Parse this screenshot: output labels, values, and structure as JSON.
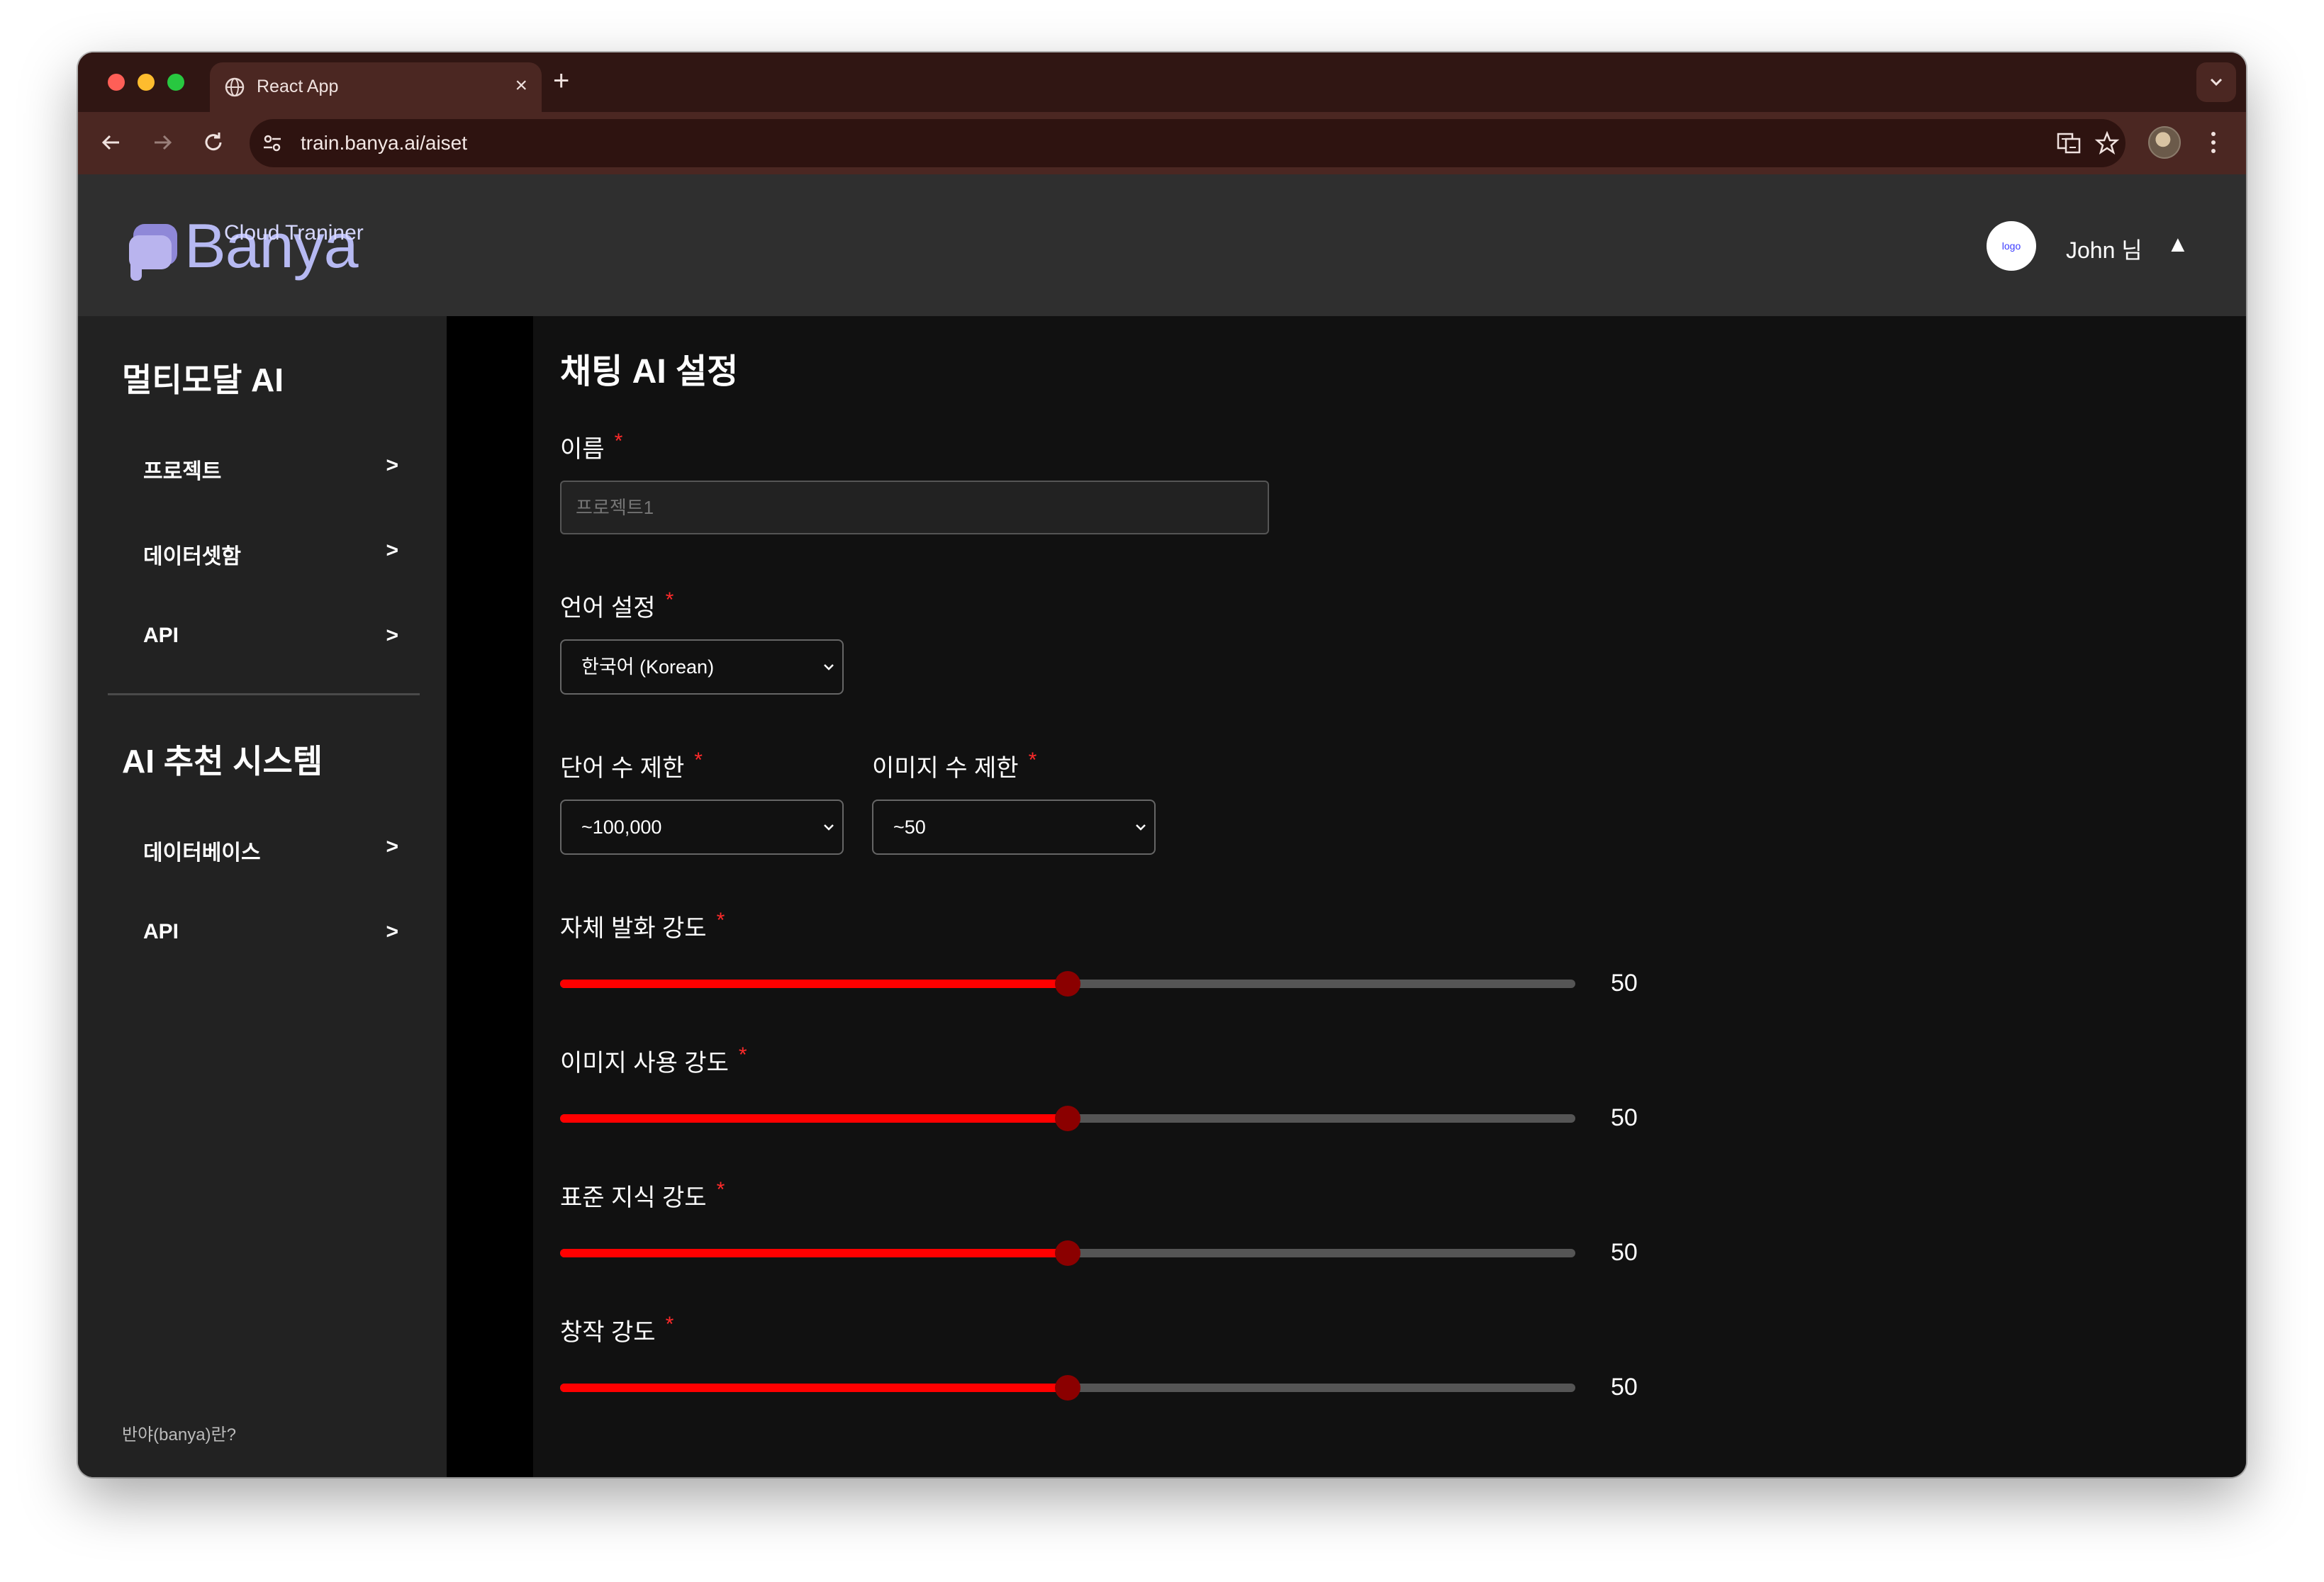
{
  "browser": {
    "tab_title": "React App",
    "tab_close": "×",
    "new_tab": "+",
    "url": "train.banya.ai/aiset"
  },
  "header": {
    "logo_word": "Banya",
    "logo_sub": "Cloud Traniner",
    "user_logo_text": "logo",
    "user_name": "John 님",
    "user_caret": "▲"
  },
  "sidebar": {
    "section1_title": "멀티모달 AI",
    "section1_items": [
      {
        "label": "프로젝트",
        "chevron": ">"
      },
      {
        "label": "데이터셋함",
        "chevron": ">"
      },
      {
        "label": "API",
        "chevron": ">"
      }
    ],
    "section2_title": "AI 추천 시스템",
    "section2_items": [
      {
        "label": "데이터베이스",
        "chevron": ">"
      },
      {
        "label": "API",
        "chevron": ">"
      }
    ],
    "footer": "반야(banya)란?"
  },
  "main": {
    "title": "채팅 AI 설정",
    "required_mark": "*",
    "name": {
      "label": "이름",
      "placeholder": "프로젝트1"
    },
    "language": {
      "label": "언어 설정",
      "value": "한국어 (Korean)"
    },
    "word_limit": {
      "label": "단어 수 제한",
      "value": "~100,000"
    },
    "image_limit": {
      "label": "이미지 수 제한",
      "value": "~50"
    },
    "sliders": [
      {
        "label": "자체 발화 강도",
        "value": "50",
        "percent": 50
      },
      {
        "label": "이미지 사용 강도",
        "value": "50",
        "percent": 50
      },
      {
        "label": "표준 지식 강도",
        "value": "50",
        "percent": 50
      },
      {
        "label": "창작 강도",
        "value": "50",
        "percent": 50
      }
    ]
  },
  "colors": {
    "accent": "#ff0000",
    "thumb": "#8b0000",
    "required": "#ff2a2a",
    "logo": "#b6b9f2"
  },
  "icons": [
    "globe-icon",
    "back-arrow-icon",
    "forward-arrow-icon",
    "reload-icon",
    "tune-icon",
    "translate-icon",
    "star-icon",
    "kebab-menu-icon",
    "chevron-down-icon"
  ]
}
